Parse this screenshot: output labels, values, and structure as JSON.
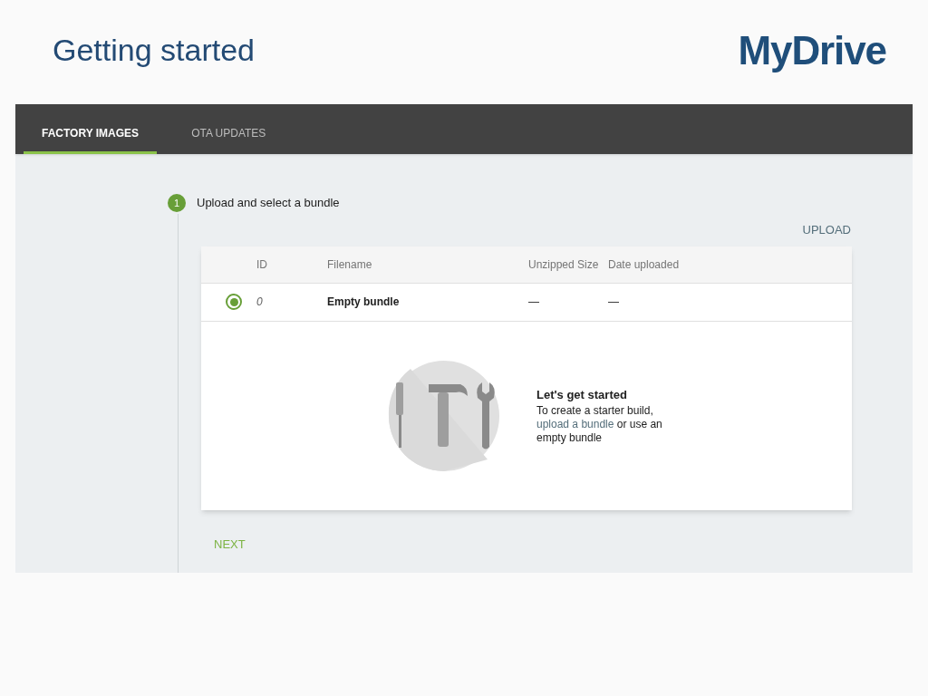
{
  "slide": {
    "title": "Getting started",
    "logo": "MyDrive"
  },
  "tabs": [
    {
      "label": "FACTORY IMAGES",
      "selected": true
    },
    {
      "label": "OTA UPDATES",
      "selected": false
    }
  ],
  "step": {
    "number": "1",
    "title": "Upload and select a bundle",
    "action": "UPLOAD"
  },
  "table": {
    "columns": [
      "ID",
      "Filename",
      "Unzipped Size",
      "Date uploaded"
    ],
    "rows": [
      {
        "selected": true,
        "id": "0",
        "filename": "Empty bundle",
        "size": "—",
        "date": "—"
      }
    ]
  },
  "empty_state": {
    "heading": "Let's get started",
    "before": "To create a starter build,",
    "link": "upload a bundle",
    "after": "or use an empty bundle"
  },
  "next_button": "NEXT"
}
